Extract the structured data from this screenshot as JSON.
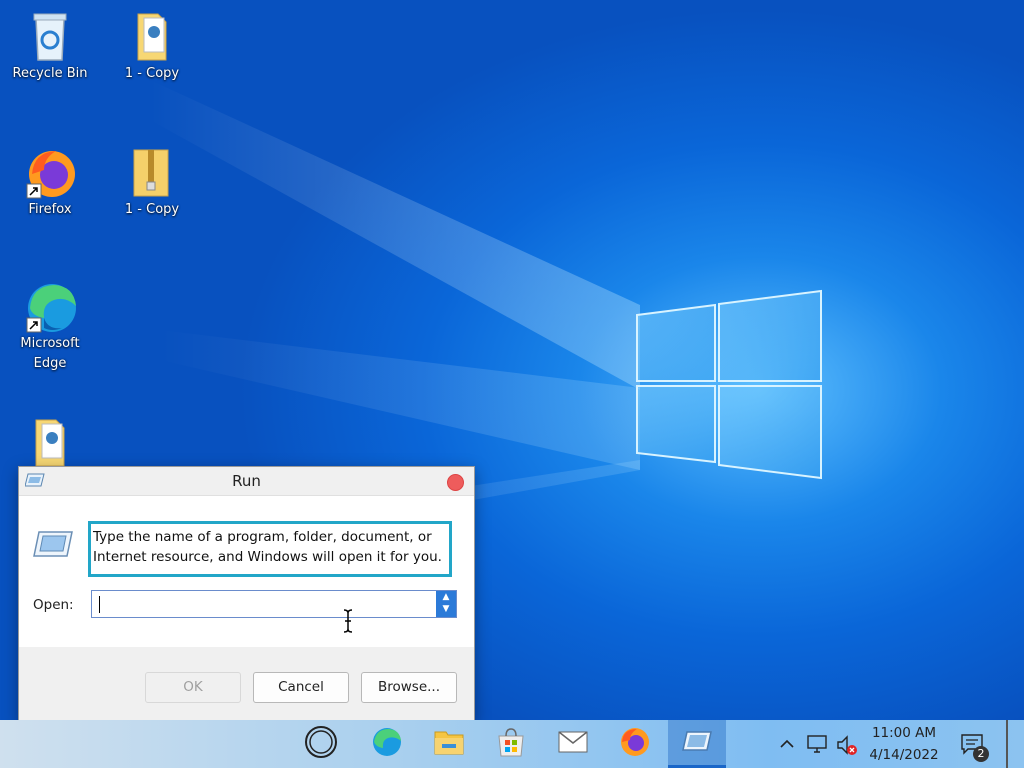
{
  "desktop": {
    "icons": [
      {
        "label": "Recycle Bin",
        "icon": "recycle-bin-icon"
      },
      {
        "label": "1 - Copy",
        "icon": "document-folder-icon"
      },
      {
        "label": "Firefox",
        "icon": "firefox-icon"
      },
      {
        "label": "1 - Copy",
        "icon": "zip-folder-icon"
      },
      {
        "label": "Microsoft Edge",
        "icon": "edge-icon"
      },
      {
        "label": "",
        "icon": "document-folder-icon"
      }
    ]
  },
  "run_dialog": {
    "title": "Run",
    "description": "Type the name of a program, folder, document, or Internet resource, and Windows will open it for you.",
    "open_label": "Open:",
    "open_value": "",
    "buttons": {
      "ok": "OK",
      "cancel": "Cancel",
      "browse": "Browse..."
    }
  },
  "taskbar": {
    "items": [
      {
        "name": "cortana",
        "icon": "cortana-icon"
      },
      {
        "name": "edge",
        "icon": "edge-icon"
      },
      {
        "name": "file-explorer",
        "icon": "file-explorer-icon"
      },
      {
        "name": "store",
        "icon": "store-icon"
      },
      {
        "name": "mail",
        "icon": "mail-icon"
      },
      {
        "name": "firefox",
        "icon": "firefox-icon"
      },
      {
        "name": "run",
        "icon": "run-icon",
        "active": true
      }
    ],
    "tray": {
      "time": "11:00 AM",
      "date": "4/14/2022",
      "notification_count": "2"
    }
  },
  "colors": {
    "accent": "#22a6c8",
    "close_button": "#ee5c5c",
    "taskbar_active": "#1a66c8"
  }
}
